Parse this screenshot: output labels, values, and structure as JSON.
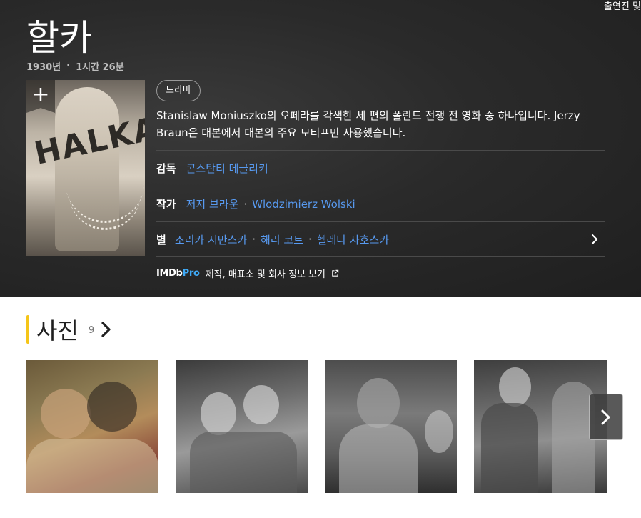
{
  "header": {
    "corner_text": "출연진 및"
  },
  "title": {
    "name": "할카",
    "year": "1930년",
    "runtime": "1시간 26분"
  },
  "poster": {
    "text": "HALKA",
    "add_label": "+"
  },
  "genres": [
    "드라마"
  ],
  "plot": "Stanislaw Moniuszko의 오페라를 각색한 세 편의 폴란드 전쟁 전 영화 중 하나입니다. Jerzy Braun은 대본에서 대본의 주요 모티프만 사용했습니다.",
  "credits": {
    "director": {
      "label": "감독",
      "names": [
        "콘스탄티 메글리키"
      ]
    },
    "writers": {
      "label": "작가",
      "names": [
        "저지 브라운",
        "Wlodzimierz Wolski"
      ]
    },
    "stars": {
      "label": "별",
      "names": [
        "조리카 시만스카",
        "해리 코트",
        "헬레나 자호스카"
      ]
    }
  },
  "imdbpro": {
    "logo_imdb": "IMDb",
    "logo_pro": "Pro",
    "text": "제작, 매표소 및 회사 정보 보기"
  },
  "photos": {
    "title": "사진",
    "count": "9"
  },
  "colors": {
    "accent": "#f5c518",
    "link": "#5799ef",
    "hero_bg": "#2a2a2a",
    "pro_blue": "#3fa9f5"
  },
  "icons": [
    "plus-icon",
    "chevron-right-icon",
    "external-link-icon"
  ]
}
